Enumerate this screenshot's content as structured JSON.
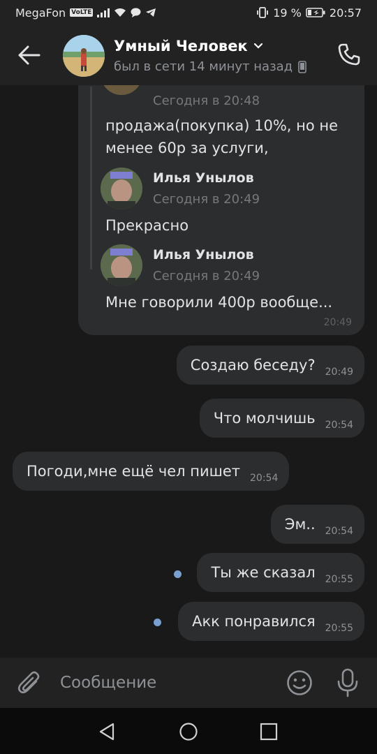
{
  "status_bar": {
    "carrier": "MegaFon",
    "volte": "VoLTE",
    "battery": "19 %",
    "time": "20:57"
  },
  "header": {
    "name": "Умный Человек",
    "status": "был в сети 14 минут назад",
    "icons": [
      "back-arrow-icon",
      "chevron-down-icon",
      "phone-device-icon",
      "phone-call-icon"
    ]
  },
  "forwarded": {
    "first_time": "Сегодня в 20:48",
    "first_text": "продажа(покупка) 10%, но не менее 60р за услуги,",
    "items": [
      {
        "author": "Илья Унылов",
        "time": "Сегодня в 20:49",
        "text": "Прекрасно"
      },
      {
        "author": "Илья Унылов",
        "time": "Сегодня в 20:49",
        "text": "Мне говорили 400р вообще..."
      }
    ],
    "bubble_time": "20:49"
  },
  "messages": [
    {
      "text": "Создаю беседу?",
      "time": "20:49",
      "direction": "out",
      "unread": false
    },
    {
      "text": "Что молчишь",
      "time": "20:54",
      "direction": "out",
      "unread": false
    },
    {
      "text": "Погоди,мне ещё чел пишет",
      "time": "20:54",
      "direction": "in",
      "unread": false
    },
    {
      "text": "Эм..",
      "time": "20:54",
      "direction": "out",
      "unread": false
    },
    {
      "text": "Ты же сказал",
      "time": "20:55",
      "direction": "out",
      "unread": true
    },
    {
      "text": "Акк понравился",
      "time": "20:55",
      "direction": "out",
      "unread": true
    }
  ],
  "composer": {
    "placeholder": "Сообщение",
    "icons": [
      "paperclip-icon",
      "emoji-icon",
      "microphone-icon"
    ]
  },
  "colors": {
    "background": "#19191a",
    "bar": "#222222",
    "bubble": "#2c2d2e",
    "unread_dot": "#7aa0cf"
  }
}
